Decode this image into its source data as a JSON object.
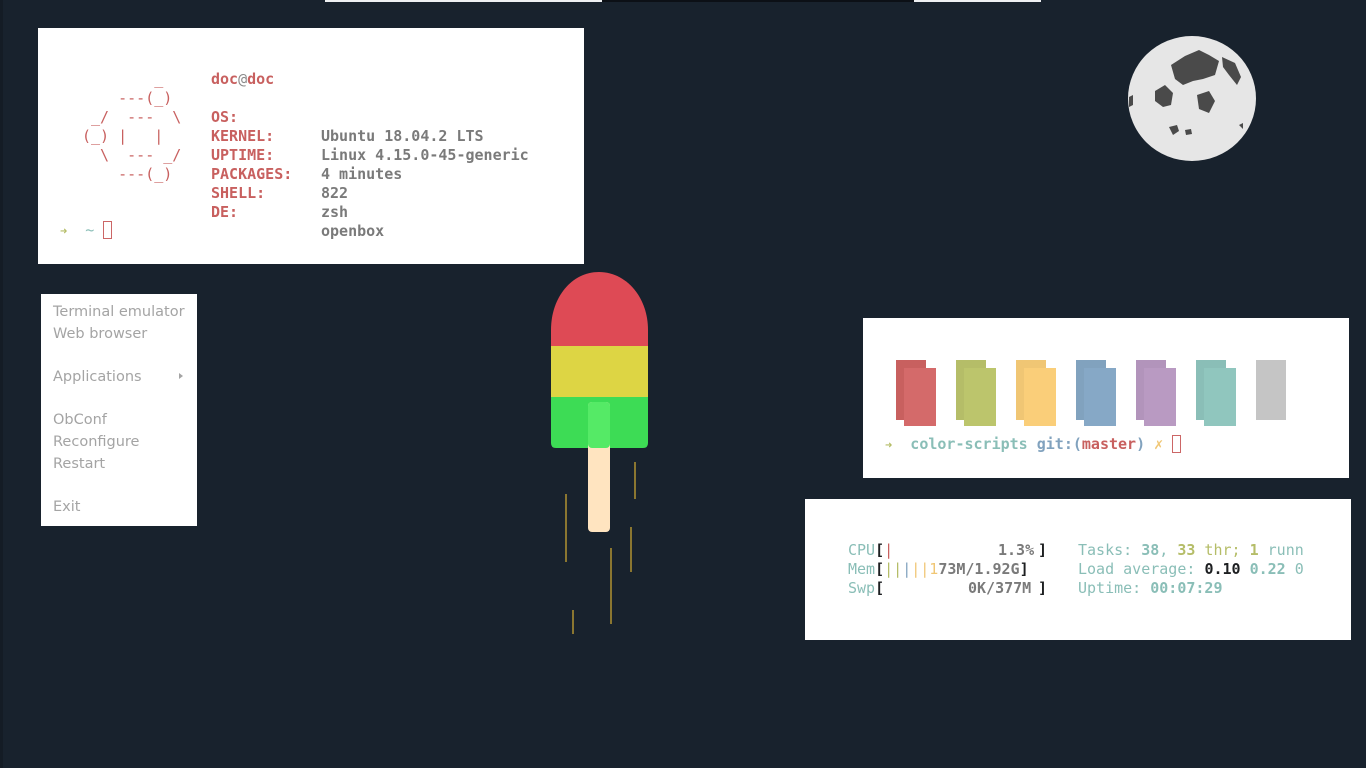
{
  "fetch": {
    "ascii": "        _\n    ---(_)\n _/  ---  \\\n(_) |   |\n  \\  --- _/\n    ---(_)",
    "user": "doc",
    "at": "@",
    "host": "doc",
    "rows": [
      {
        "key": "OS:",
        "value": "Ubuntu 18.04.2 LTS"
      },
      {
        "key": "KERNEL:",
        "value": "Linux 4.15.0-45-generic"
      },
      {
        "key": "UPTIME:",
        "value": "4 minutes"
      },
      {
        "key": "PACKAGES:",
        "value": "822"
      },
      {
        "key": "SHELL:",
        "value": "zsh"
      },
      {
        "key": "DE:",
        "value": "openbox"
      }
    ],
    "prompt_arrow": "➜",
    "prompt_dir": "~"
  },
  "colors": {
    "swatches": [
      {
        "name": "red",
        "back": "#c8605f",
        "front": "#cc6666"
      },
      {
        "name": "green",
        "back": "#b5bd68",
        "front": "#b5bd68"
      },
      {
        "name": "yellow",
        "back": "#f0c674",
        "front": "#f0c674"
      },
      {
        "name": "blue",
        "back": "#81a2be",
        "front": "#81a2be"
      },
      {
        "name": "magenta",
        "back": "#b294bb",
        "front": "#b294bb"
      },
      {
        "name": "cyan",
        "back": "#8abeb7",
        "front": "#8abeb7"
      },
      {
        "name": "white",
        "back": "#c5c5c5",
        "front": "#c5c5c5"
      }
    ],
    "prompt_arrow": "➜",
    "prompt_dir": "color-scripts",
    "git_label": "git:",
    "git_open": "(",
    "git_branch": "master",
    "git_close": ")",
    "git_dirty": "✗"
  },
  "htop": {
    "cpu_label": "CPU",
    "cpu_open": "[",
    "cpu_bar": "|",
    "cpu_value": "1.3%",
    "cpu_close": "]",
    "mem_label": "Mem",
    "mem_open": "[",
    "mem_bar_green": "||",
    "mem_bar_blue": "|",
    "mem_bar_yellow": "||1",
    "mem_value": "73M/1.92G",
    "mem_close": "]",
    "swp_label": "Swp",
    "swp_open": "[",
    "swp_value": "0K/377M",
    "swp_close": "]",
    "tasks_label": "Tasks: ",
    "tasks_count": "38",
    "tasks_sep": ", ",
    "threads_count": "33",
    "threads_label": " thr; ",
    "running_count": "1",
    "running_label": " runn",
    "load_label": "Load average: ",
    "load_1": "0.10",
    "load_5": "0.22",
    "load_15": "0",
    "uptime_label": "Uptime: ",
    "uptime_value": "00:07:29"
  },
  "menu": {
    "items": [
      {
        "label": "Terminal emulator"
      },
      {
        "label": "Web browser"
      },
      {
        "label": "Applications"
      },
      {
        "label": "ObConf"
      },
      {
        "label": "Reconfigure"
      },
      {
        "label": "Restart"
      },
      {
        "label": "Exit"
      }
    ]
  },
  "wallpaper": {
    "popsicle_colors": [
      "#de4a55",
      "#ddd544",
      "#3ddc55",
      "#ffe4c0"
    ],
    "moon_color": "#e6e6e6",
    "crater_color": "#4a4a4a"
  }
}
